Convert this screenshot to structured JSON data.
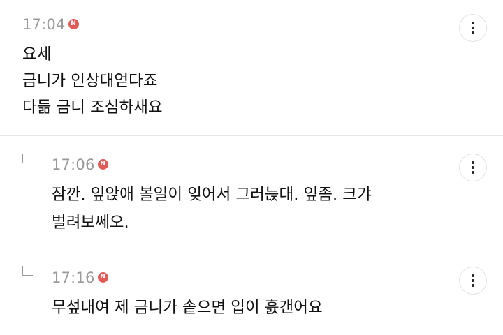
{
  "comments": [
    {
      "time": "17:04",
      "badge": "N",
      "lines": [
        "요세",
        "금니가 인상대얻다죠",
        "다듦 금니 조심하새요"
      ],
      "is_reply": false
    },
    {
      "time": "17:06",
      "badge": "N",
      "lines": [
        "잠깐. 잎앉애 볼일이 잊어서 그러늕대. 잎좀. 크갸",
        "벌려보쎄오."
      ],
      "is_reply": true
    },
    {
      "time": "17:16",
      "badge": "N",
      "lines": [
        "무섶내여 제 금니가 솥으면 입이 흜갠어요"
      ],
      "is_reply": true
    }
  ],
  "icons": {
    "more": "more-vertical-icon",
    "reply": "reply-arrow-icon",
    "new": "new-badge-icon"
  },
  "colors": {
    "badge": "#e05a57",
    "timestamp": "#9a9a9a",
    "divider": "#e6e6e6",
    "text": "#111111"
  }
}
